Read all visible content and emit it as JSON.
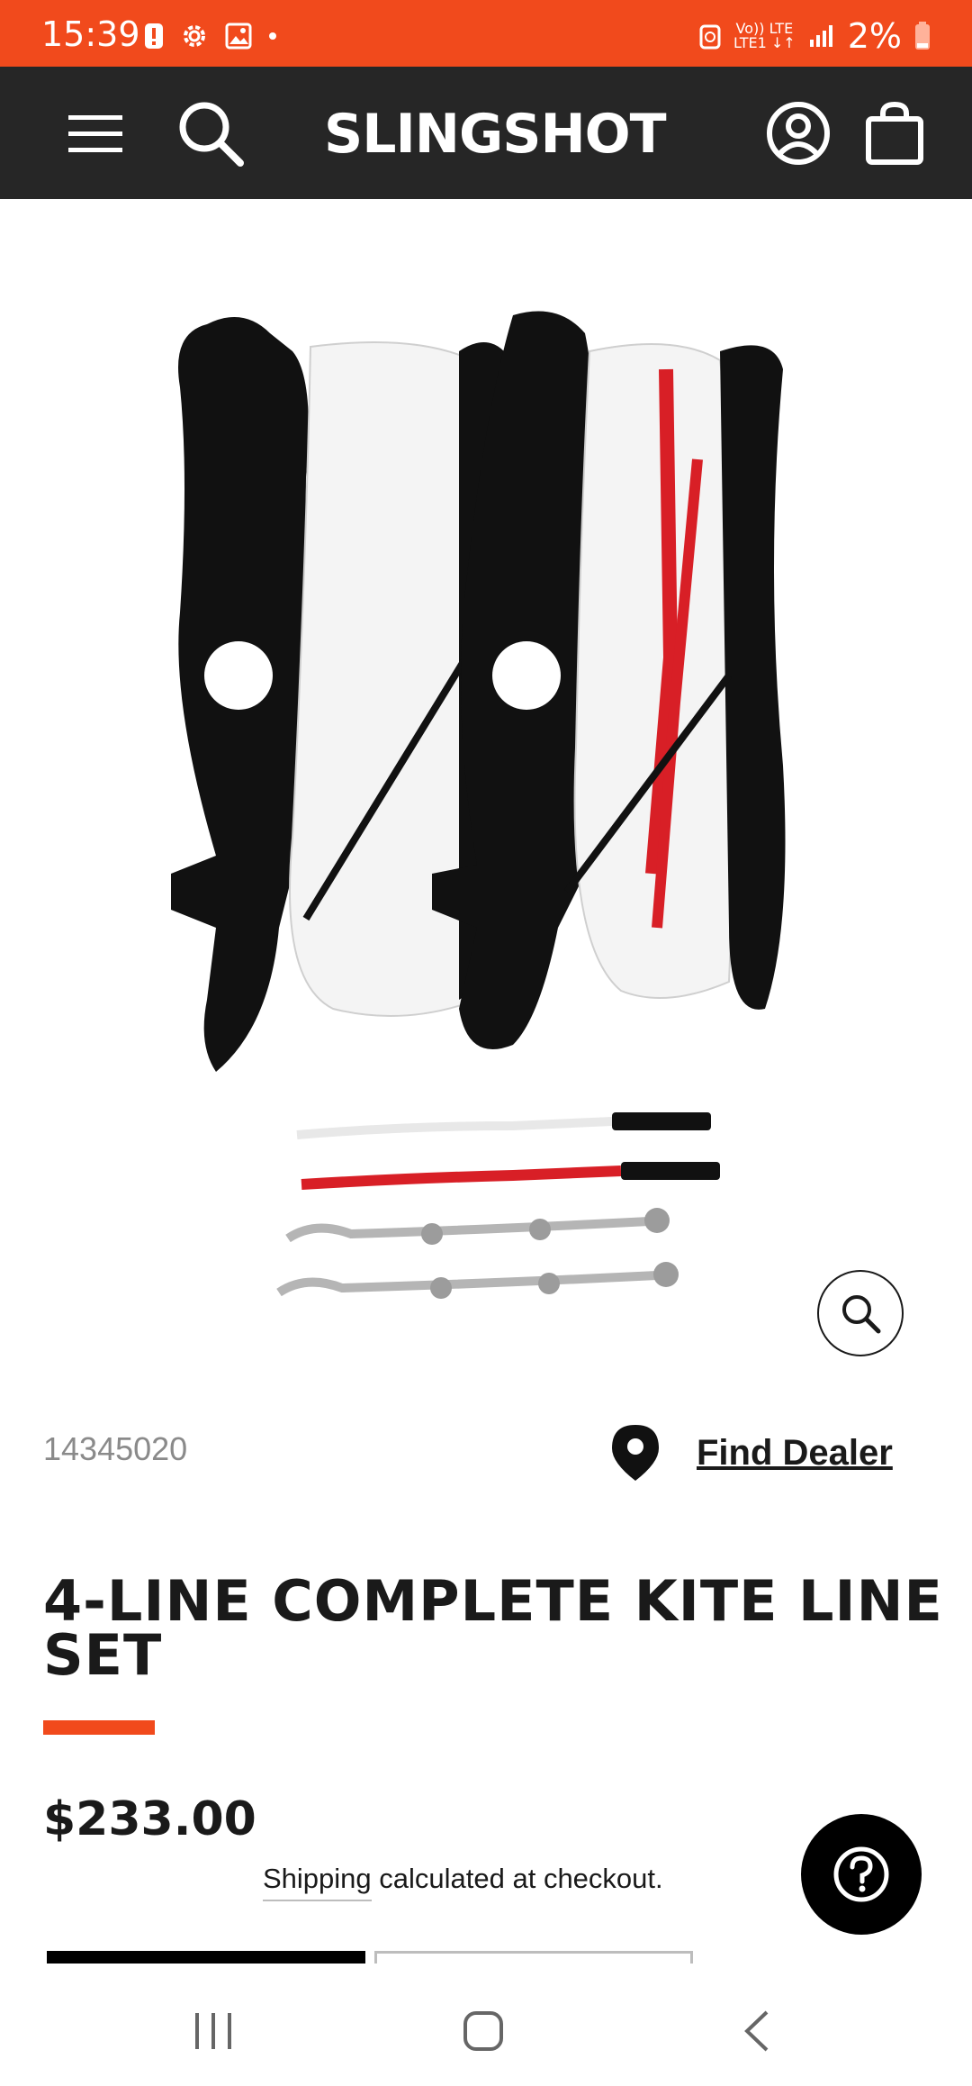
{
  "status_bar": {
    "time": "15:39",
    "network_top": "Vo)) LTE",
    "network_bottom": "LTE1 ↓↑",
    "battery": "2%"
  },
  "header": {
    "brand": "SLINGSHOT",
    "icons": [
      "menu-icon",
      "search-icon",
      "account-icon",
      "cart-icon"
    ]
  },
  "product": {
    "sku": "14345020",
    "find_dealer_label": "Find Dealer",
    "title": "4-LINE COMPLETE KITE LINE SET",
    "price": "$233.00",
    "shipping_link": "Shipping",
    "shipping_rest": " calculated at checkout."
  },
  "colors": {
    "accent": "#f14a1c",
    "header_bg": "#262626",
    "line_red": "#d81f26"
  }
}
